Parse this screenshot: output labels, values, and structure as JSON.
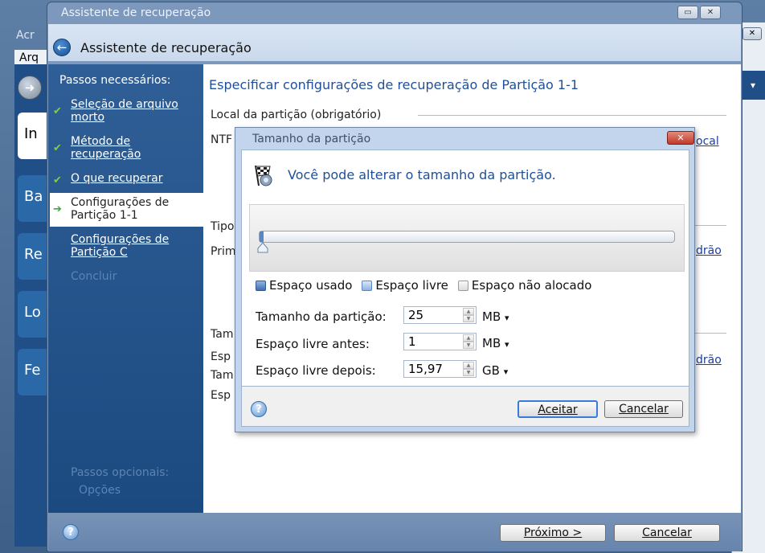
{
  "background_app": {
    "title_fragment": "Acr",
    "menu_fragment": "Arq",
    "tabs": [
      "In",
      "Ba",
      "Re",
      "Lo",
      "Fe"
    ]
  },
  "window": {
    "title": "Assistente de recuperação",
    "header_title": "Assistente de recuperação"
  },
  "sidebar": {
    "heading": "Passos necessários:",
    "steps": [
      {
        "label": "Seleção de arquivo morto",
        "line1": "Seleção de arquivo",
        "line2": "morto",
        "state": "done"
      },
      {
        "label": "Método de recuperação",
        "line1": "Método de",
        "line2": "recuperação",
        "state": "done"
      },
      {
        "label": "O que recuperar",
        "line1": "O que recuperar",
        "line2": "",
        "state": "done"
      },
      {
        "label": "Configurações de Partição 1-1",
        "line1": "Configurações de",
        "line2": "Partição 1-1",
        "state": "current"
      },
      {
        "label": "Configurações de Partição C",
        "line1": "Configurações de",
        "line2": "Partição C",
        "state": "pending"
      },
      {
        "label": "Concluir",
        "line1": "Concluir",
        "line2": "",
        "state": "disabled"
      }
    ],
    "optional_heading": "Passos opcionais:",
    "optional_item": "Opções"
  },
  "content": {
    "title": "Especificar configurações de recuperação de Partição 1-1",
    "location_label": "Local da partição (obrigatório)",
    "cut_labels": [
      "NTF",
      "Tipo",
      "Prim",
      "Tam",
      "Esp",
      "Tam",
      "Esp"
    ],
    "link_local": "ocal",
    "link_padrao_1": "drão",
    "link_padrao_2": "drão"
  },
  "footer": {
    "next_button": "Próximo >",
    "cancel_button": "Cancelar"
  },
  "dialog": {
    "title": "Tamanho da partição",
    "heading": "Você pode alterar o tamanho da partição.",
    "used_fraction": 0.01,
    "legend": {
      "used": "Espaço usado",
      "free": "Espaço livre",
      "unallocated": "Espaço não alocado"
    },
    "fields": [
      {
        "label": "Tamanho da partição:",
        "value": "25",
        "unit": "MB"
      },
      {
        "label": "Espaço livre antes:",
        "value": "1",
        "unit": "MB"
      },
      {
        "label": "Espaço livre depois:",
        "value": "15,97",
        "unit": "GB"
      }
    ],
    "accept_button": "Aceitar",
    "cancel_button": "Cancelar"
  },
  "colors": {
    "accent": "#1f4f99",
    "sidebar": "#1a4a80",
    "used_space": "#5a86c4"
  }
}
